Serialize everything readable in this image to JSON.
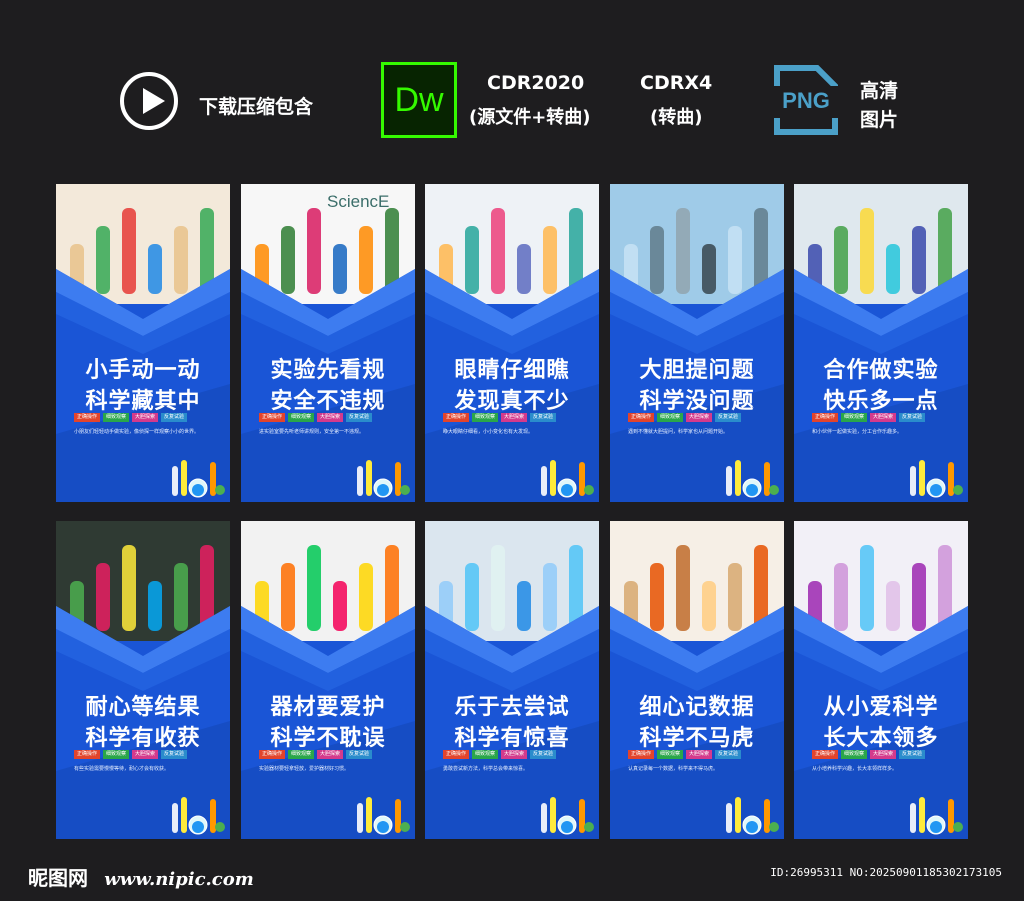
{
  "header": {
    "download_label": "下载压缩包含",
    "dw_label": "Dw",
    "cdr2020_label": "CDR2020",
    "cdr2020_sub": "(源文件+转曲)",
    "cdrx4_label": "CDRX4",
    "cdrx4_sub": "(转曲)",
    "png_label": "PNG",
    "hd_line1": "高清",
    "hd_line2": "图片"
  },
  "colors": {
    "background": "#1e1d1f",
    "card_blue": "#1a55d6",
    "dw_green": "#35fa00",
    "png_blue": "#4ba0c8"
  },
  "tags": [
    {
      "label": "正确操作",
      "color": "#e2442c"
    },
    {
      "label": "细致观察",
      "color": "#2aa64a"
    },
    {
      "label": "大胆探索",
      "color": "#d43a8c"
    },
    {
      "label": "反复试验",
      "color": "#2a8ccc"
    }
  ],
  "cards": [
    {
      "line1": "小手动一动",
      "line2": "科学藏其中",
      "photo_text": "",
      "body": "小朋友们轻轻动手做实验，像侦探一样观察小小的世界。"
    },
    {
      "line1": "实验先看规",
      "line2": "安全不违规",
      "photo_text": "SciencE",
      "body": "进实验室要先听老师讲规则，安全第一不违规。"
    },
    {
      "line1": "眼睛仔细瞧",
      "line2": "发现真不少",
      "photo_text": "",
      "body": "睁大眼睛仔细看，小小变化也有大发现。"
    },
    {
      "line1": "大胆提问题",
      "line2": "科学没问题",
      "photo_text": "",
      "body": "遇到不懂就大胆提问，科学家也从问题开始。"
    },
    {
      "line1": "合作做实验",
      "line2": "快乐多一点",
      "photo_text": "",
      "body": "和小伙伴一起做实验，分工合作乐趣多。"
    },
    {
      "line1": "耐心等结果",
      "line2": "科学有收获",
      "photo_text": "",
      "body": "有些实验需要慢慢等待，耐心才会有收获。"
    },
    {
      "line1": "器材要爱护",
      "line2": "科学不耽误",
      "photo_text": "",
      "body": "实验器材要轻拿轻放，爱护器材好习惯。"
    },
    {
      "line1": "乐于去尝试",
      "line2": "科学有惊喜",
      "photo_text": "",
      "body": "勇敢尝试新方法，科学总会带来惊喜。"
    },
    {
      "line1": "细心记数据",
      "line2": "科学不马虎",
      "photo_text": "",
      "body": "认真记录每一个数据，科学来不得马虎。"
    },
    {
      "line1": "从小爱科学",
      "line2": "长大本领多",
      "photo_text": "",
      "body": "从小培养科学兴趣，长大本领样样多。"
    }
  ],
  "footer": {
    "logo": "昵图网",
    "site": "www.nipic.com",
    "id_text": "ID:26995311 NO:20250901185302173105"
  }
}
